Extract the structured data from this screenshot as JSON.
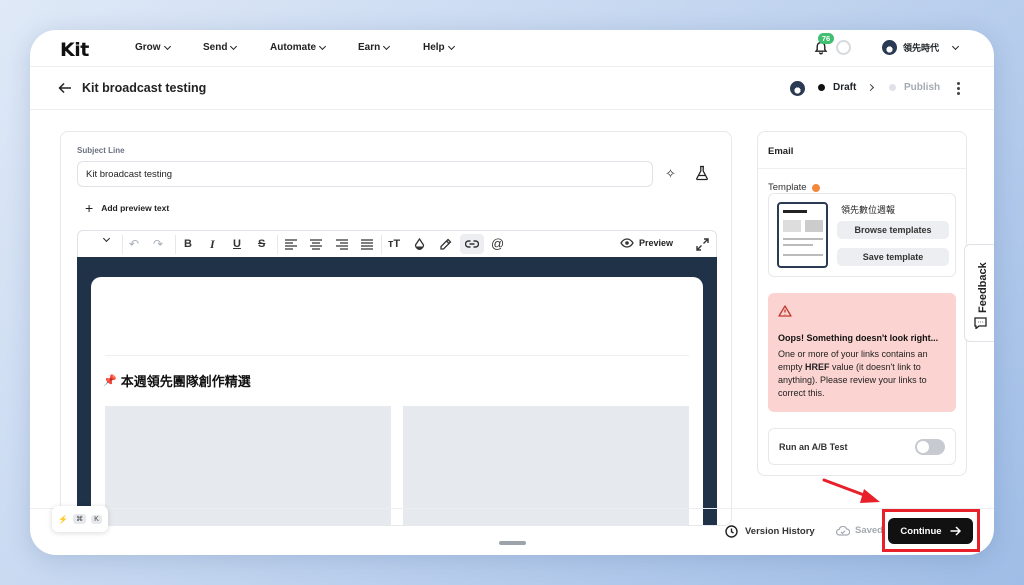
{
  "nav": {
    "logo": "Kit",
    "items": [
      {
        "label": "Grow"
      },
      {
        "label": "Send"
      },
      {
        "label": "Automate"
      },
      {
        "label": "Earn"
      },
      {
        "label": "Help"
      }
    ],
    "notification_count": "76",
    "user_name": "領先時代"
  },
  "header": {
    "title": "Kit broadcast testing",
    "step_draft": "Draft",
    "step_publish": "Publish"
  },
  "editor": {
    "subject_label": "Subject Line",
    "subject_value": "Kit broadcast testing",
    "add_preview_text": "Add preview text",
    "preview_label": "Preview",
    "content_heading": "本週領先團隊創作精選"
  },
  "sidebar": {
    "heading": "Email",
    "template_label": "Template",
    "template_name": "領先數位週報",
    "browse_templates": "Browse templates",
    "save_template": "Save template",
    "alert_title": "Oops! Something doesn't look right...",
    "alert_body_1": "One or more of your links contains an empty ",
    "alert_body_bold": "HREF",
    "alert_body_2": " value (it doesn't link to anything). Please review your links to correct this.",
    "ab_test_label": "Run an A/B Test"
  },
  "feedback": {
    "label": "Feedback"
  },
  "footer": {
    "version_history": "Version History",
    "saved": "Saved",
    "continue": "Continue",
    "kbd_cmd": "⌘",
    "kbd_k": "K"
  },
  "colors": {
    "accent_dark": "#111111",
    "highlight_red": "#e8202a",
    "alert_bg": "#fbd3d0",
    "badge_green": "#3fbf6f",
    "email_canvas": "#1f3248"
  }
}
